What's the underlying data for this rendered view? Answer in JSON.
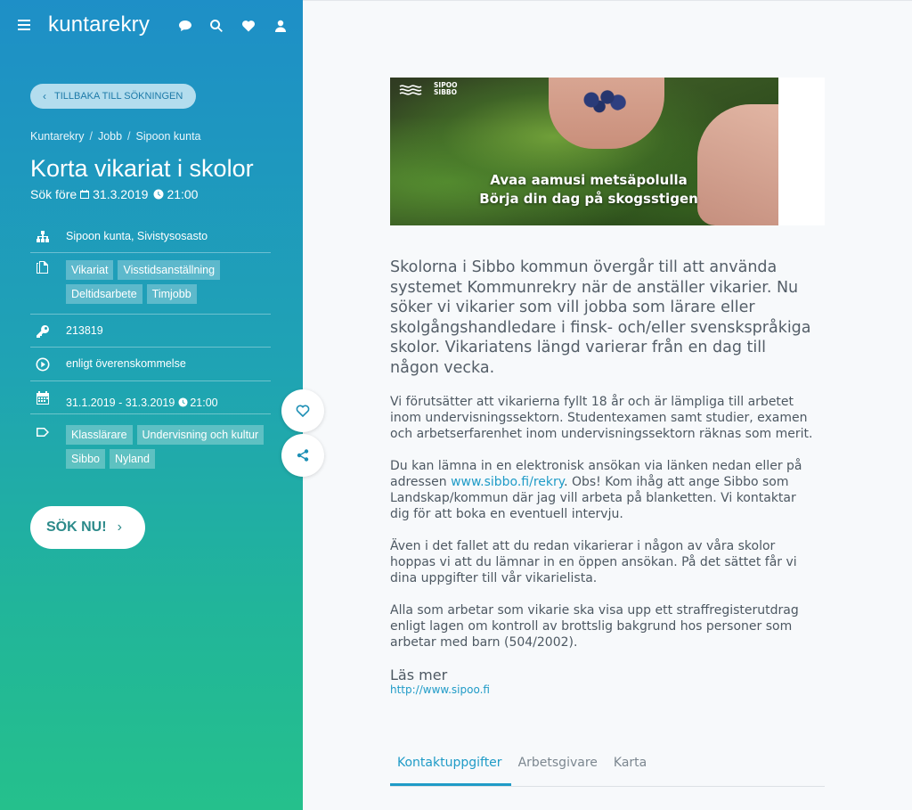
{
  "app": {
    "logo": "kuntarekry"
  },
  "nav": {
    "back_label": "TILLBAKA TILL SÖKNINGEN",
    "breadcrumb": [
      "Kuntarekry",
      "Jobb",
      "Sipoon kunta"
    ]
  },
  "job": {
    "title": "Korta vikariat i skolor",
    "deadline_prefix": "Sök före",
    "deadline_date": "31.3.2019",
    "deadline_time": "21:00",
    "organization": "Sipoon kunta, Sivistysosasto",
    "employment_tags": [
      "Vikariat",
      "Visstidsanställning",
      "Deltidsarbete",
      "Timjobb"
    ],
    "job_id": "213819",
    "salary": "enligt överenskommelse",
    "period_dates": "31.1.2019 - 31.3.2019",
    "period_time": "21:00",
    "category_tags": [
      "Klasslärare",
      "Undervisning och kultur",
      "Sibbo",
      "Nyland"
    ],
    "apply_label": "SÖK NU!"
  },
  "banner": {
    "brand_line1": "SIPOO",
    "brand_line2": "SIBBO",
    "line1": "Avaa aamusi metsäpolulla",
    "line2": "Börja din dag på skogsstigen"
  },
  "article": {
    "lead": "Skolorna i Sibbo kommun övergår till att använda systemet Kommunrekry när de anställer vikarier. Nu söker vi vikarier som vill jobba som lärare eller skolgångshandledare i finsk- och/eller svenskspråkiga skolor. Vikariatens längd varierar från en dag till någon vecka.",
    "para1": "Vi förutsätter att vikarierna fyllt 18 år och är lämpliga till arbetet inom undervisningssektorn. Studentexamen samt studier, examen och arbetserfarenhet inom undervisningssektorn räknas som merit.",
    "para2_before": "Du kan lämna in en elektronisk ansökan via länken nedan eller på adressen ",
    "para2_link": "www.sibbo.fi/rekry",
    "para2_after": ". Obs! Kom ihåg att ange Sibbo som Landskap/kommun där jag vill arbeta på blanketten. Vi kontaktar dig för att boka en eventuell intervju.",
    "para3": "Även i det fallet att du redan vikarierar i någon av våra skolor hoppas vi att du lämnar in en öppen ansökan. På det sättet får vi dina uppgifter till vår vikarielista.",
    "para4": "Alla som arbetar som vikarie ska visa upp ett straffregisterutdrag enligt lagen om kontroll av brottslig bakgrund hos personer som arbetar med barn (504/2002).",
    "read_more": "Läs mer",
    "ext_link": "http://www.sipoo.fi"
  },
  "tabs": [
    "Kontaktuppgifter",
    "Arbetsgivare",
    "Karta"
  ],
  "colors": {
    "accent": "#1f9bc7",
    "sidebar_top": "#1e8fc7",
    "sidebar_bottom": "#25c08c"
  }
}
